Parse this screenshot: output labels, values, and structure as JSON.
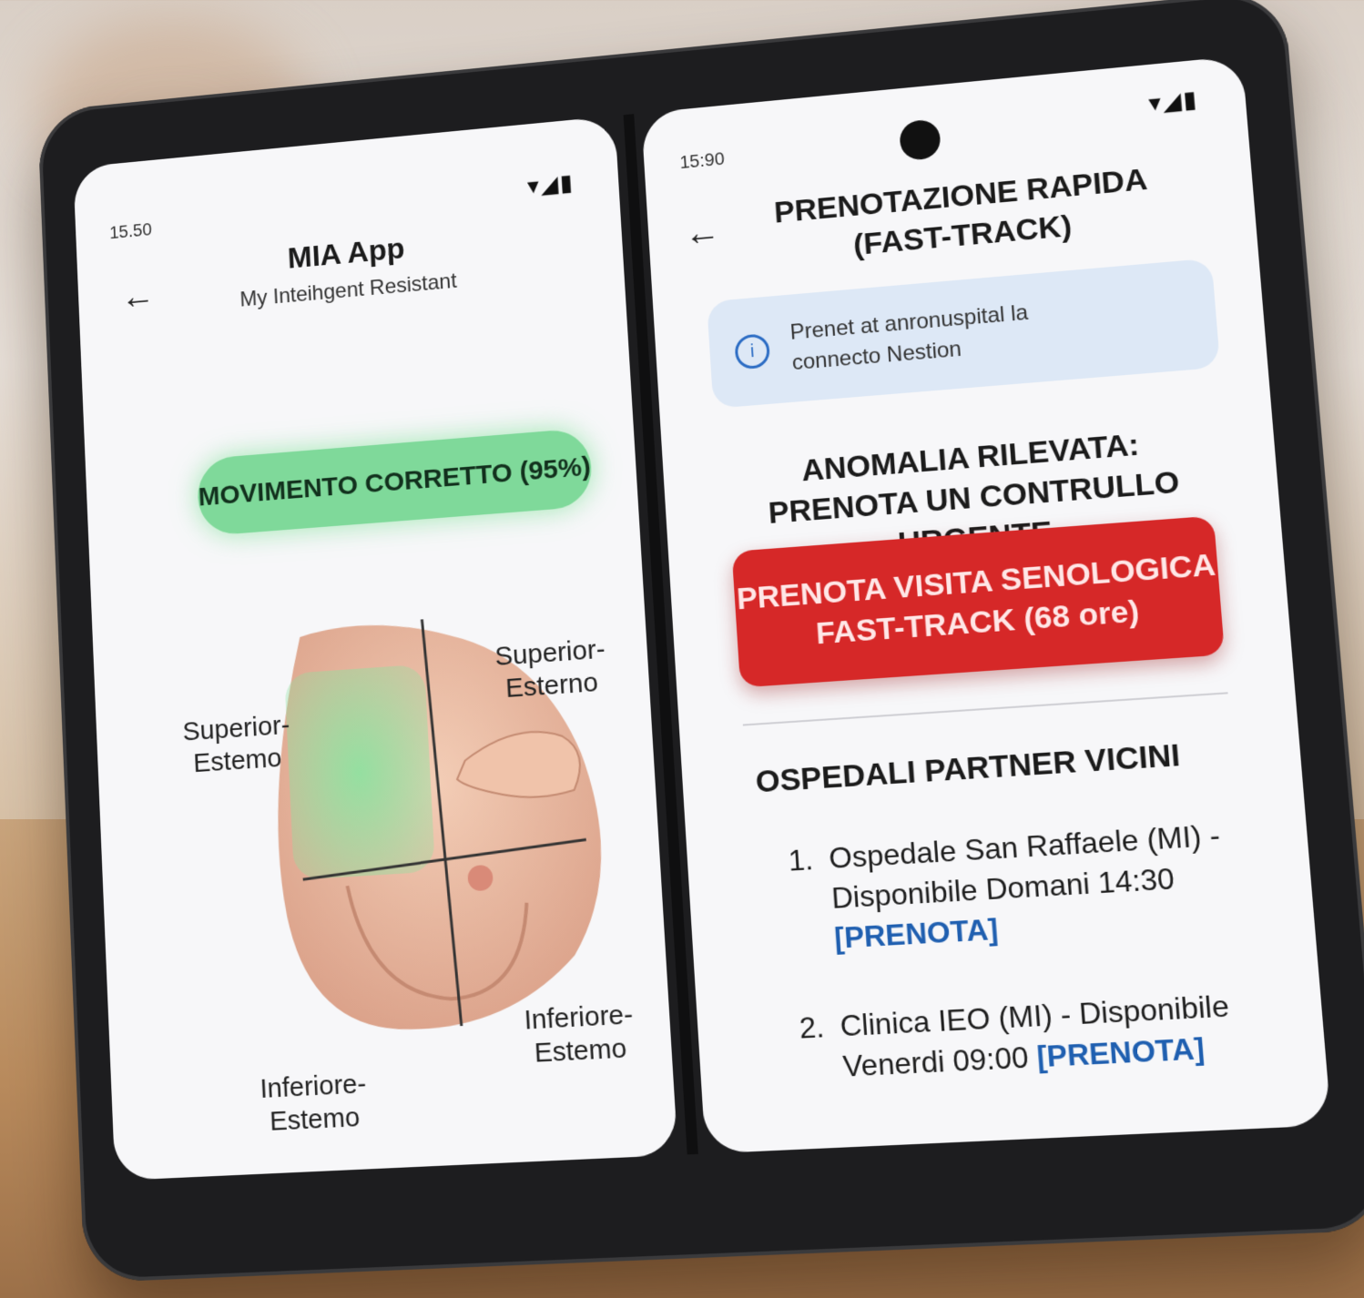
{
  "left_screen": {
    "status_time": "15.50",
    "status_icons": "▾◢▮",
    "back_icon": "arrow-left-icon",
    "app_title": "MIA App",
    "app_subtitle": "My Inteihgent Resistant",
    "movement_status": "MOVIMENTO CORRETTO (95%)",
    "quadrants": {
      "top_left": [
        "Superior-",
        "Estemo"
      ],
      "top_right": [
        "Superior-",
        "Esterno"
      ],
      "bottom_left": [
        "Inferiore-",
        "Estemo"
      ],
      "bottom_right": [
        "Inferiore-",
        "Estemo"
      ]
    },
    "colors": {
      "status_green": "#7fd99a",
      "highlight": "#8be3a0"
    }
  },
  "right_screen": {
    "status_time": "15:90",
    "status_icons": "▾◢▮",
    "back_icon": "arrow-left-icon",
    "title_line1": "PRENOTAZIONE RAPIDA",
    "title_line2": "(FAST-TRACK)",
    "info_icon": "info-circle-icon",
    "info_line1": "Prenet at anronuspital la",
    "info_line2": "connecto Nestion",
    "alert_line1": "ANOMALIA RILEVATA:",
    "alert_line2": "PRENOTA UN CONTRULLO URGENTE",
    "urgent_button_line1": "PRENOTA VISITA SENOLOGICA",
    "urgent_button_line2": "FAST-TRACK (68 ore)",
    "section_title": "OSPEDALI PARTNER VICINI",
    "hospitals": [
      {
        "number": "1.",
        "text": "Ospedale San Raffaele (MI) - Disponibile Domani 14:30",
        "link": "[PRENOTA]"
      },
      {
        "number": "2.",
        "text": "Clinica IEO (MI) - Disponibile Venerdi 09:00",
        "link": "[PRENOTA]"
      }
    ],
    "colors": {
      "urgent_red": "#d62828",
      "link_blue": "#1f5fb0",
      "info_bg": "#dde8f6"
    }
  }
}
